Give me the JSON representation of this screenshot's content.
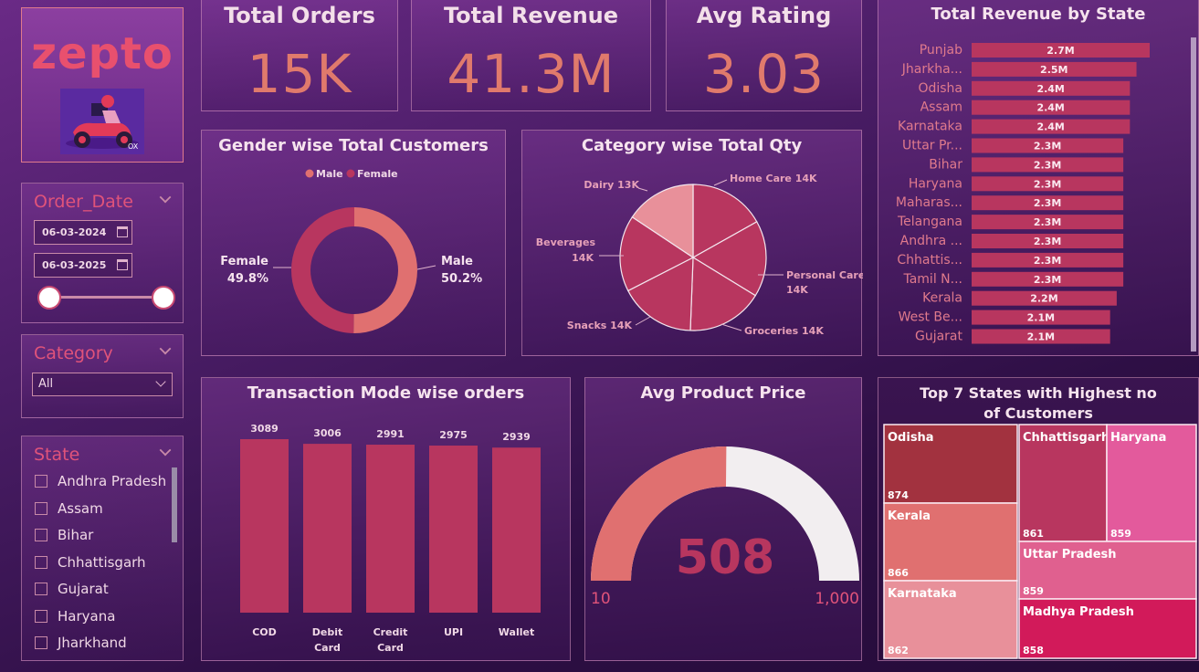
{
  "brand": {
    "logo_text": "zepto",
    "scooter_tag": "OX"
  },
  "kpis": [
    {
      "title": "Total Orders",
      "value": "15K"
    },
    {
      "title": "Total Revenue",
      "value": "41.3M"
    },
    {
      "title": "Avg Rating",
      "value": "3.03"
    }
  ],
  "order_date": {
    "title": "Order_Date",
    "start": "06-03-2024",
    "end": "06-03-2025",
    "range_fraction": [
      0,
      1
    ]
  },
  "category_slicer": {
    "title": "Category",
    "selected": "All"
  },
  "state_slicer": {
    "title": "State",
    "items": [
      "Andhra Pradesh",
      "Assam",
      "Bihar",
      "Chhattisgarh",
      "Gujarat",
      "Haryana",
      "Jharkhand"
    ]
  },
  "colors": {
    "primary": "#b8365f",
    "light": "#e07a6c",
    "pink": "#e8909a",
    "bg": "#4a1d66"
  },
  "chart_data": [
    {
      "type": "pie",
      "variant": "donut",
      "title": "Gender wise Total Customers",
      "legend": "top",
      "slices": [
        {
          "name": "Male",
          "value": 50.2,
          "label": "50.2%",
          "color": "#e07070"
        },
        {
          "name": "Female",
          "value": 49.8,
          "label": "49.8%",
          "color": "#b8365f"
        }
      ]
    },
    {
      "type": "pie",
      "title": "Category wise Total Qty",
      "slices": [
        {
          "name": "Home Care",
          "value": 14,
          "label": "Home Care 14K"
        },
        {
          "name": "Personal Care",
          "value": 14,
          "label": "Personal Care 14K"
        },
        {
          "name": "Groceries",
          "value": 14,
          "label": "Groceries 14K"
        },
        {
          "name": "Snacks",
          "value": 14,
          "label": "Snacks 14K"
        },
        {
          "name": "Beverages",
          "value": 14,
          "label": "Beverages 14K"
        },
        {
          "name": "Dairy",
          "value": 13,
          "label": "Dairy 13K"
        }
      ]
    },
    {
      "type": "bar",
      "orientation": "horizontal",
      "title": "Total Revenue by State",
      "categories": [
        "Punjab",
        "Jharkha...",
        "Odisha",
        "Assam",
        "Karnataka",
        "Uttar Pr...",
        "Bihar",
        "Haryana",
        "Maharas...",
        "Telangana",
        "Andhra ...",
        "Chhattis...",
        "Tamil N...",
        "Kerala",
        "West Be...",
        "Gujarat"
      ],
      "values": [
        2.7,
        2.5,
        2.4,
        2.4,
        2.4,
        2.3,
        2.3,
        2.3,
        2.3,
        2.3,
        2.3,
        2.3,
        2.3,
        2.2,
        2.1,
        2.1
      ],
      "labels": [
        "2.7M",
        "2.5M",
        "2.4M",
        "2.4M",
        "2.4M",
        "2.3M",
        "2.3M",
        "2.3M",
        "2.3M",
        "2.3M",
        "2.3M",
        "2.3M",
        "2.3M",
        "2.2M",
        "2.1M",
        "2.1M"
      ],
      "xlim": [
        0,
        3.1
      ]
    },
    {
      "type": "bar",
      "title": "Transaction Mode wise orders",
      "categories": [
        "COD",
        "Debit\nCard",
        "Credit\nCard",
        "UPI",
        "Wallet"
      ],
      "values": [
        3089,
        3006,
        2991,
        2975,
        2939
      ],
      "ylim": [
        0,
        3300
      ]
    },
    {
      "type": "gauge",
      "title": "Avg Product Price",
      "value": 508,
      "min": 10,
      "max": 1000,
      "min_label": "10",
      "max_label": "1,000",
      "value_label": "508"
    },
    {
      "type": "treemap",
      "title": "Top 7 States with Highest no of Customers",
      "items": [
        {
          "name": "Odisha",
          "value": 874,
          "color": "#a2323f"
        },
        {
          "name": "Kerala",
          "value": 866,
          "color": "#e07070"
        },
        {
          "name": "Karnataka",
          "value": 862,
          "color": "#e8909a"
        },
        {
          "name": "Chhattisgarh",
          "value": 861,
          "color": "#b8365f"
        },
        {
          "name": "Haryana",
          "value": 859,
          "color": "#e35a9c"
        },
        {
          "name": "Uttar Pradesh",
          "value": 859,
          "color": "#e0608f"
        },
        {
          "name": "Madhya Pradesh",
          "value": 858,
          "color": "#d21a5a"
        }
      ]
    }
  ]
}
